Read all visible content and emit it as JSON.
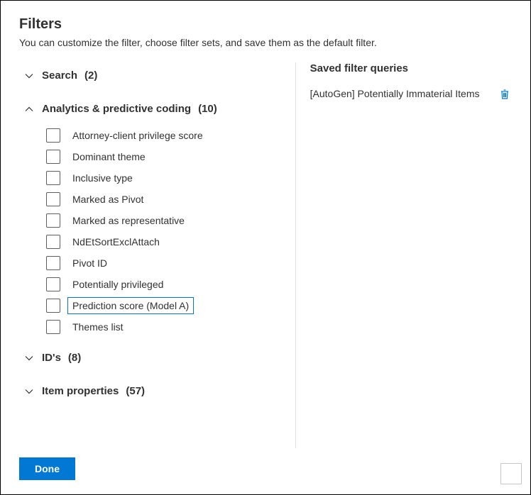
{
  "header": {
    "title": "Filters",
    "subtitle": "You can customize the filter, choose filter sets, and save them as the default filter."
  },
  "sections": {
    "search": {
      "label": "Search",
      "count": "(2)"
    },
    "analytics": {
      "label": "Analytics & predictive coding",
      "count": "(10)",
      "items": [
        "Attorney-client privilege score",
        "Dominant theme",
        "Inclusive type",
        "Marked as Pivot",
        "Marked as representative",
        "NdEtSortExclAttach",
        "Pivot ID",
        "Potentially privileged",
        "Prediction score (Model A)",
        "Themes list"
      ]
    },
    "ids": {
      "label": "ID's",
      "count": "(8)"
    },
    "item_props": {
      "label": "Item properties",
      "count": "(57)"
    }
  },
  "saved": {
    "title": "Saved filter queries",
    "items": [
      "[AutoGen] Potentially Immaterial Items"
    ]
  },
  "footer": {
    "done": "Done"
  }
}
